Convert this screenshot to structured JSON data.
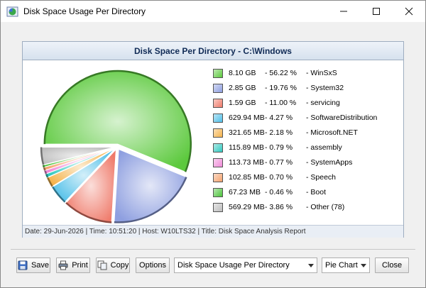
{
  "window": {
    "title": "Disk Space Usage Per Directory",
    "controls": [
      "minimize",
      "maximize",
      "close"
    ]
  },
  "report": {
    "title": "Disk Space Per Directory - C:\\Windows",
    "status": "Date: 29-Jun-2026 | Time: 10:51:20 | Host: W10LTS32 | Title: Disk Space Analysis Report"
  },
  "chart_data": {
    "type": "pie",
    "slices": [
      {
        "size": "8.10 GB",
        "percent": 56.22,
        "percent_label": "- 56.22 %",
        "name": "- WinSxS",
        "color": "#5cc93d"
      },
      {
        "size": "2.85 GB",
        "percent": 19.76,
        "percent_label": "- 19.76 %",
        "name": "- System32",
        "color": "#8e9fe0"
      },
      {
        "size": "1.59 GB",
        "percent": 11.0,
        "percent_label": "- 11.00 %",
        "name": "- servicing",
        "color": "#ef7a6a"
      },
      {
        "size": "629.94 MB",
        "percent": 4.27,
        "percent_label": "- 4.27 %",
        "name": "- SoftwareDistribution",
        "color": "#4fbfe8"
      },
      {
        "size": "321.65 MB",
        "percent": 2.18,
        "percent_label": "- 2.18 %",
        "name": "- Microsoft.NET",
        "color": "#f4b24a"
      },
      {
        "size": "115.89 MB",
        "percent": 0.79,
        "percent_label": "- 0.79 %",
        "name": "- assembly",
        "color": "#30c9c0"
      },
      {
        "size": "113.73 MB",
        "percent": 0.77,
        "percent_label": "- 0.77 %",
        "name": "- SystemApps",
        "color": "#f08ad8"
      },
      {
        "size": "102.85 MB",
        "percent": 0.7,
        "percent_label": "- 0.70 %",
        "name": "- Speech",
        "color": "#f5a36e"
      },
      {
        "size": "67.23 MB",
        "percent": 0.46,
        "percent_label": "- 0.46 %",
        "name": "- Boot",
        "color": "#4cc43a"
      },
      {
        "size": "569.29 MB",
        "percent": 3.86,
        "percent_label": "- 3.86 %",
        "name": "- Other (78)",
        "color": "#bdbdbd"
      }
    ]
  },
  "toolbar": {
    "save": "Save",
    "print": "Print",
    "copy": "Copy",
    "options": "Options",
    "report_select": "Disk Space Usage Per Directory",
    "view_select": "Pie Chart",
    "close": "Close"
  }
}
